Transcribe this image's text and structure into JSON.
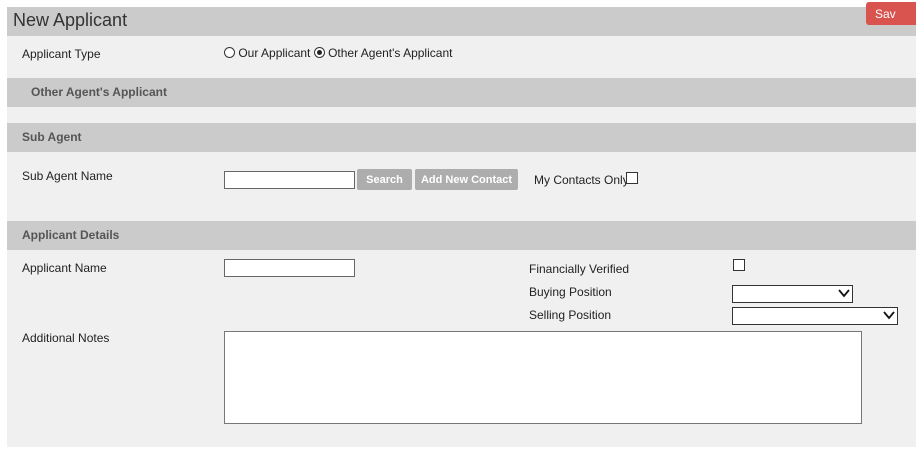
{
  "header": {
    "title": "New Applicant",
    "save_label": "Sav"
  },
  "applicant_type": {
    "label": "Applicant Type",
    "options": [
      {
        "label": "Our Applicant",
        "selected": false
      },
      {
        "label": "Other Agent's Applicant",
        "selected": true
      }
    ]
  },
  "sections": {
    "other_agent": "Other Agent's Applicant",
    "sub_agent": "Sub Agent",
    "applicant_details": "Applicant Details"
  },
  "sub_agent": {
    "name_label": "Sub Agent Name",
    "name_value": "",
    "search_label": "Search",
    "add_contact_label": "Add New Contact",
    "my_contacts_label": "My Contacts Only",
    "my_contacts_checked": false
  },
  "details": {
    "applicant_name_label": "Applicant Name",
    "applicant_name_value": "",
    "financially_verified_label": "Financially Verified",
    "financially_verified_checked": false,
    "buying_position_label": "Buying Position",
    "buying_position_value": "",
    "selling_position_label": "Selling Position",
    "selling_position_value": "",
    "additional_notes_label": "Additional Notes",
    "additional_notes_value": ""
  },
  "colors": {
    "save_button": "#d9534f",
    "section_bar": "#cbcbcb",
    "panel": "#f0f0f0",
    "grey_button": "#adadad"
  }
}
